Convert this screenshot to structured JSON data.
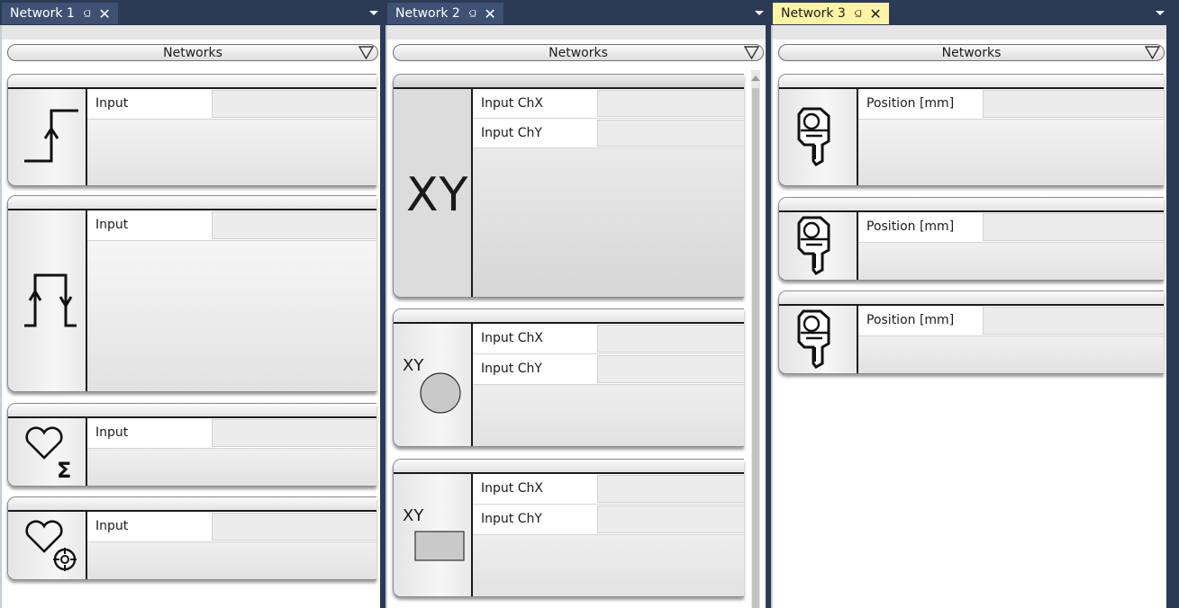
{
  "panes": [
    {
      "tab_label": "Network 1",
      "pin_glyph": "⫑",
      "close_glyph": "✕",
      "selector_label": "Networks",
      "cards": [
        {
          "icon": "rising-edge-trigger-icon",
          "inputs": [
            {
              "label": "Input",
              "value": ""
            }
          ]
        },
        {
          "icon": "pulse-trigger-icon",
          "inputs": [
            {
              "label": "Input",
              "value": ""
            }
          ]
        },
        {
          "icon": "heart-sum-icon",
          "inputs": [
            {
              "label": "Input",
              "value": ""
            }
          ]
        },
        {
          "icon": "heart-target-icon",
          "inputs": [
            {
              "label": "Input",
              "value": ""
            }
          ]
        }
      ]
    },
    {
      "tab_label": "Network 2",
      "pin_glyph": "⫑",
      "close_glyph": "✕",
      "selector_label": "Networks",
      "cards": [
        {
          "icon": "xy-large-icon",
          "icon_text": "XY",
          "inputs": [
            {
              "label": "Input ChX",
              "value": ""
            },
            {
              "label": "Input ChY",
              "value": ""
            }
          ]
        },
        {
          "icon": "xy-circle-icon",
          "icon_text": "XY",
          "inputs": [
            {
              "label": "Input ChX",
              "value": ""
            },
            {
              "label": "Input ChY",
              "value": ""
            }
          ]
        },
        {
          "icon": "xy-rectangle-icon",
          "icon_text": "XY",
          "inputs": [
            {
              "label": "Input ChX",
              "value": ""
            },
            {
              "label": "Input ChY",
              "value": ""
            }
          ]
        }
      ]
    },
    {
      "tab_label": "Network 3",
      "pin_glyph": "⫑",
      "close_glyph": "✕",
      "selector_label": "Networks",
      "cards": [
        {
          "icon": "position-sensor-icon",
          "inputs": [
            {
              "label": "Position [mm]",
              "value": ""
            }
          ]
        },
        {
          "icon": "position-sensor-icon",
          "inputs": [
            {
              "label": "Position [mm]",
              "value": ""
            }
          ]
        },
        {
          "icon": "position-sensor-icon",
          "inputs": [
            {
              "label": "Position [mm]",
              "value": ""
            }
          ]
        }
      ]
    }
  ],
  "colors": {
    "background": "#2b3a55",
    "tab_inactive": "#3e5174",
    "tab_active": "#fdf3a4"
  }
}
